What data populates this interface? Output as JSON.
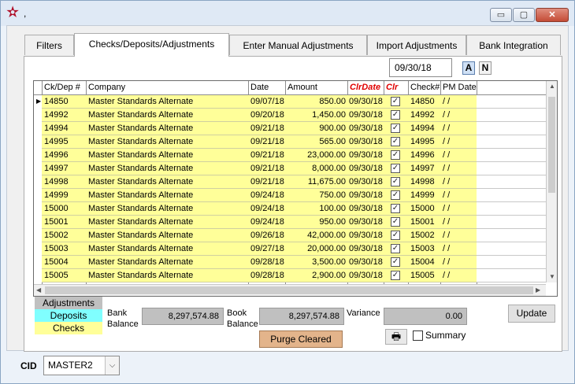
{
  "window": {
    "title": ",",
    "min_label": "▭",
    "max_label": "▢",
    "close_label": "✕"
  },
  "tabs": [
    {
      "label": "Filters"
    },
    {
      "label": "Checks/Deposits/Adjustments"
    },
    {
      "label": "Enter Manual Adjustments"
    },
    {
      "label": "Import Adjustments"
    },
    {
      "label": "Bank Integration"
    }
  ],
  "filter": {
    "date": "09/30/18",
    "btn_a": "A",
    "btn_n": "N"
  },
  "grid": {
    "headers": [
      "Ck/Dep #",
      "Company",
      "Date",
      "Amount",
      "ClrDate",
      "Clr",
      "Check#",
      "PM Date"
    ],
    "rows": [
      {
        "ck": "14850",
        "company": "Master Standards Alternate",
        "date": "09/07/18",
        "amount": "850.00",
        "clrdate": "09/30/18",
        "check": "14850",
        "pm": "/ /"
      },
      {
        "ck": "14992",
        "company": "Master Standards Alternate",
        "date": "09/20/18",
        "amount": "1,450.00",
        "clrdate": "09/30/18",
        "check": "14992",
        "pm": "/ /"
      },
      {
        "ck": "14994",
        "company": "Master Standards Alternate",
        "date": "09/21/18",
        "amount": "900.00",
        "clrdate": "09/30/18",
        "check": "14994",
        "pm": "/ /"
      },
      {
        "ck": "14995",
        "company": "Master Standards Alternate",
        "date": "09/21/18",
        "amount": "565.00",
        "clrdate": "09/30/18",
        "check": "14995",
        "pm": "/ /"
      },
      {
        "ck": "14996",
        "company": "Master Standards Alternate",
        "date": "09/21/18",
        "amount": "23,000.00",
        "clrdate": "09/30/18",
        "check": "14996",
        "pm": "/ /"
      },
      {
        "ck": "14997",
        "company": "Master Standards Alternate",
        "date": "09/21/18",
        "amount": "8,000.00",
        "clrdate": "09/30/18",
        "check": "14997",
        "pm": "/ /"
      },
      {
        "ck": "14998",
        "company": "Master Standards Alternate",
        "date": "09/21/18",
        "amount": "11,675.00",
        "clrdate": "09/30/18",
        "check": "14998",
        "pm": "/ /"
      },
      {
        "ck": "14999",
        "company": "Master Standards Alternate",
        "date": "09/24/18",
        "amount": "750.00",
        "clrdate": "09/30/18",
        "check": "14999",
        "pm": "/ /"
      },
      {
        "ck": "15000",
        "company": "Master Standards Alternate",
        "date": "09/24/18",
        "amount": "100.00",
        "clrdate": "09/30/18",
        "check": "15000",
        "pm": "/ /"
      },
      {
        "ck": "15001",
        "company": "Master Standards Alternate",
        "date": "09/24/18",
        "amount": "950.00",
        "clrdate": "09/30/18",
        "check": "15001",
        "pm": "/ /"
      },
      {
        "ck": "15002",
        "company": "Master Standards Alternate",
        "date": "09/26/18",
        "amount": "42,000.00",
        "clrdate": "09/30/18",
        "check": "15002",
        "pm": "/ /"
      },
      {
        "ck": "15003",
        "company": "Master Standards Alternate",
        "date": "09/27/18",
        "amount": "20,000.00",
        "clrdate": "09/30/18",
        "check": "15003",
        "pm": "/ /"
      },
      {
        "ck": "15004",
        "company": "Master Standards Alternate",
        "date": "09/28/18",
        "amount": "3,500.00",
        "clrdate": "09/30/18",
        "check": "15004",
        "pm": "/ /"
      },
      {
        "ck": "15005",
        "company": "Master Standards Alternate",
        "date": "09/28/18",
        "amount": "2,900.00",
        "clrdate": "09/30/18",
        "check": "15005",
        "pm": "/ /"
      }
    ]
  },
  "legend": {
    "adjustments": "Adjustments",
    "deposits": "Deposits",
    "checks": "Checks"
  },
  "balances": {
    "bank_label_1": "Bank",
    "bank_label_2": "Balance",
    "bank_value": "8,297,574.88",
    "book_label_1": "Book",
    "book_label_2": "Balance",
    "book_value": "8,297,574.88",
    "variance_label": "Variance",
    "variance_value": "0.00"
  },
  "buttons": {
    "update": "Update",
    "purge": "Purge Cleared",
    "print_icon": "🖶",
    "summary": "Summary"
  },
  "cid": {
    "label": "CID",
    "value": "MASTER2"
  },
  "colors": {
    "yellow_row": "#ffff99",
    "deposits": "#80ffff",
    "checks": "#ffff99",
    "adjustments": "#c0c0c0",
    "purge": "#e3b48b",
    "red_header": "#e00000"
  },
  "icons": {
    "app": "star-icon",
    "print": "printer-icon",
    "dropdown": "chevron-down-icon"
  }
}
